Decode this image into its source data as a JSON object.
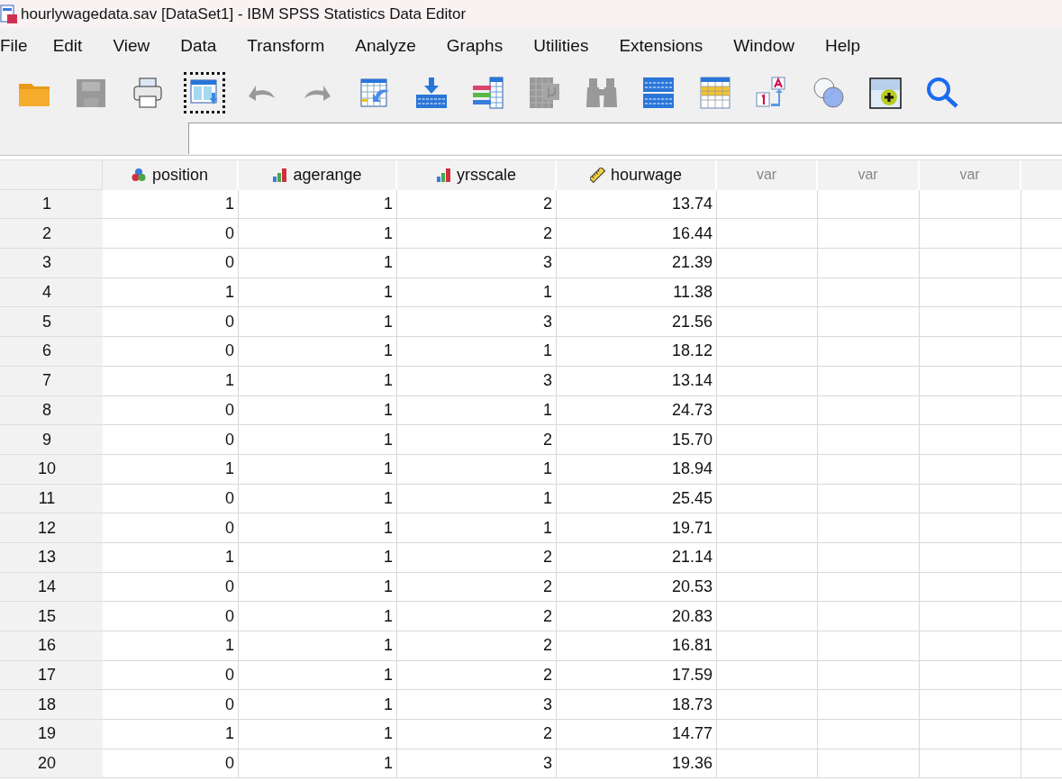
{
  "window": {
    "title": "hourlywagedata.sav [DataSet1] - IBM SPSS Statistics Data Editor"
  },
  "menu": [
    "File",
    "Edit",
    "View",
    "Data",
    "Transform",
    "Analyze",
    "Graphs",
    "Utilities",
    "Extensions",
    "Window",
    "Help"
  ],
  "toolbar": [
    {
      "kind": "open",
      "disabled": false
    },
    {
      "kind": "save",
      "disabled": true
    },
    {
      "kind": "print",
      "disabled": false
    },
    {
      "kind": "recall",
      "disabled": false,
      "focused": true
    },
    {
      "kind": "undo",
      "disabled": true
    },
    {
      "kind": "redo",
      "disabled": true
    },
    {
      "kind": "gotocase",
      "disabled": false
    },
    {
      "kind": "gotovar",
      "disabled": false
    },
    {
      "kind": "variables",
      "disabled": false
    },
    {
      "kind": "stats",
      "disabled": true
    },
    {
      "kind": "find",
      "disabled": true
    },
    {
      "kind": "split",
      "disabled": false
    },
    {
      "kind": "select",
      "disabled": false
    },
    {
      "kind": "labels",
      "disabled": false
    },
    {
      "kind": "sets",
      "disabled": false
    },
    {
      "kind": "image",
      "disabled": false
    },
    {
      "kind": "search",
      "disabled": false
    }
  ],
  "table": {
    "columns": [
      {
        "name": "position",
        "kind": "nominal"
      },
      {
        "name": "agerange",
        "kind": "ordinal"
      },
      {
        "name": "yrsscale",
        "kind": "ordinal"
      },
      {
        "name": "hourwage",
        "kind": "scale"
      },
      {
        "name": "var",
        "kind": "empty"
      },
      {
        "name": "var",
        "kind": "empty"
      },
      {
        "name": "var",
        "kind": "empty"
      },
      {
        "kind": "empty"
      }
    ],
    "rows": [
      {
        "case": "1",
        "cells": [
          "1",
          "1",
          "2",
          "13.74"
        ]
      },
      {
        "case": "2",
        "cells": [
          "0",
          "1",
          "2",
          "16.44"
        ]
      },
      {
        "case": "3",
        "cells": [
          "0",
          "1",
          "3",
          "21.39"
        ]
      },
      {
        "case": "4",
        "cells": [
          "1",
          "1",
          "1",
          "11.38"
        ]
      },
      {
        "case": "5",
        "cells": [
          "0",
          "1",
          "3",
          "21.56"
        ]
      },
      {
        "case": "6",
        "cells": [
          "0",
          "1",
          "1",
          "18.12"
        ]
      },
      {
        "case": "7",
        "cells": [
          "1",
          "1",
          "3",
          "13.14"
        ]
      },
      {
        "case": "8",
        "cells": [
          "0",
          "1",
          "1",
          "24.73"
        ]
      },
      {
        "case": "9",
        "cells": [
          "0",
          "1",
          "2",
          "15.70"
        ]
      },
      {
        "case": "10",
        "cells": [
          "1",
          "1",
          "1",
          "18.94"
        ]
      },
      {
        "case": "11",
        "cells": [
          "0",
          "1",
          "1",
          "25.45"
        ]
      },
      {
        "case": "12",
        "cells": [
          "0",
          "1",
          "1",
          "19.71"
        ]
      },
      {
        "case": "13",
        "cells": [
          "1",
          "1",
          "2",
          "21.14"
        ]
      },
      {
        "case": "14",
        "cells": [
          "0",
          "1",
          "2",
          "20.53"
        ]
      },
      {
        "case": "15",
        "cells": [
          "0",
          "1",
          "2",
          "20.83"
        ]
      },
      {
        "case": "16",
        "cells": [
          "1",
          "1",
          "2",
          "16.81"
        ]
      },
      {
        "case": "17",
        "cells": [
          "0",
          "1",
          "2",
          "17.59"
        ]
      },
      {
        "case": "18",
        "cells": [
          "0",
          "1",
          "3",
          "18.73"
        ]
      },
      {
        "case": "19",
        "cells": [
          "1",
          "1",
          "2",
          "14.77"
        ]
      },
      {
        "case": "20",
        "cells": [
          "0",
          "1",
          "3",
          "19.36"
        ]
      }
    ]
  }
}
